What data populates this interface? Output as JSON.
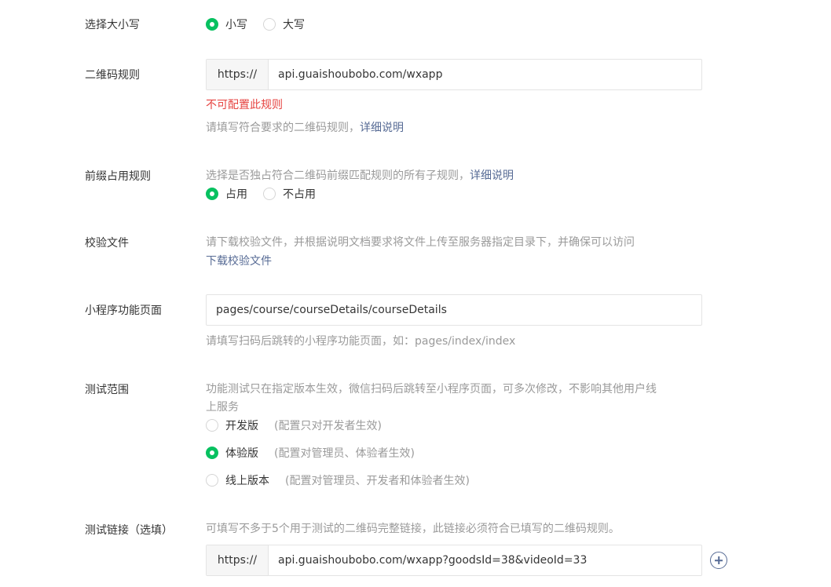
{
  "case_select": {
    "label": "选择大小写",
    "options": [
      {
        "text": "小写",
        "checked": true
      },
      {
        "text": "大写",
        "checked": false
      }
    ]
  },
  "qr_rule": {
    "label": "二维码规则",
    "prefix": "https://",
    "value": "api.guaishoubobo.com/wxapp",
    "error": "不可配置此规则",
    "tip": "请填写符合要求的二维码规则，",
    "tip_link": "详细说明"
  },
  "prefix_rule": {
    "label": "前缀占用规则",
    "tip": "选择是否独占符合二维码前缀匹配规则的所有子规则，",
    "tip_link": "详细说明",
    "options": [
      {
        "text": "占用",
        "checked": true
      },
      {
        "text": "不占用",
        "checked": false
      }
    ]
  },
  "verify_file": {
    "label": "校验文件",
    "tip": "请下载校验文件，并根据说明文档要求将文件上传至服务器指定目录下，并确保可以访问",
    "download_link": "下载校验文件"
  },
  "mini_page": {
    "label": "小程序功能页面",
    "value": "pages/course/courseDetails/courseDetails",
    "tip": "请填写扫码后跳转的小程序功能页面，如：pages/index/index"
  },
  "test_scope": {
    "label": "测试范围",
    "tip_line1": "功能测试只在指定版本生效，微信扫码后跳转至小程序页面，可多次修改，不影响其他用户线",
    "tip_line2": "上服务",
    "options": [
      {
        "text": "开发版",
        "hint": "(配置只对开发者生效)",
        "checked": false
      },
      {
        "text": "体验版",
        "hint": "(配置对管理员、体验者生效)",
        "checked": true
      },
      {
        "text": "线上版本",
        "hint": "(配置对管理员、开发者和体验者生效)",
        "checked": false
      }
    ]
  },
  "test_link": {
    "label": "测试链接（选填）",
    "tip": "可填写不多于5个用于测试的二维码完整链接，此链接必须符合已填写的二维码规则。",
    "prefix": "https://",
    "value": "api.guaishoubobo.com/wxapp?goodsId=38&videoId=33"
  },
  "colors": {
    "accent_green": "#07c160",
    "link_blue": "#576b95",
    "error_red": "#e64340",
    "tip_gray": "#9a9a9a"
  }
}
